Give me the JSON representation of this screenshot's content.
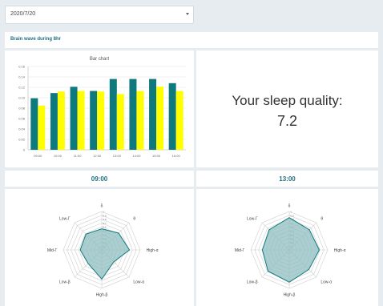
{
  "date_select": {
    "value": "2020/7/20"
  },
  "section_title": "Brain wave during 8hr",
  "chart_data": {
    "type": "bar",
    "title": "Bar chart",
    "categories": [
      "09:00",
      "10:00",
      "11:00",
      "12:00",
      "13:00",
      "14:00",
      "15:00",
      "16:00"
    ],
    "series": [
      {
        "values": [
          0.099,
          0.109,
          0.121,
          0.113,
          0.136,
          0.136,
          0.136,
          0.128
        ]
      },
      {
        "values": [
          0.085,
          0.112,
          0.113,
          0.112,
          0.107,
          0.113,
          0.121,
          0.113
        ]
      }
    ],
    "ylim": [
      0,
      0.16
    ],
    "yticks": [
      "0",
      "0.02",
      "0.04",
      "0.06",
      "0.08",
      "0.10",
      "0.12",
      "0.14",
      "0.16"
    ],
    "colors": [
      "#0e7a7e",
      "#ffff00"
    ]
  },
  "sleep_quality": {
    "label": "Your sleep quality:",
    "value": "7.2"
  },
  "radar_left": {
    "time": "09:00",
    "axes": [
      "δ",
      "θ",
      "High-α",
      "Low-α",
      "High-β",
      "Low-β",
      "Mid-Γ",
      "Low-Γ"
    ],
    "values": [
      0.55,
      0.62,
      0.72,
      0.44,
      0.76,
      0.5,
      0.56,
      0.58
    ],
    "rings": [
      "0.1",
      "0.2",
      "0.3",
      "0.4",
      "0.5",
      "0.6",
      "0.7",
      "0.8",
      "0.9",
      "1"
    ]
  },
  "radar_right": {
    "time": "13:00",
    "axes": [
      "δ",
      "θ",
      "High-α",
      "Low-α",
      "High-β",
      "Low-β",
      "Mid-Γ",
      "Low-Γ"
    ],
    "values": [
      0.84,
      0.74,
      0.78,
      0.72,
      0.84,
      0.78,
      0.7,
      0.74
    ],
    "rings": [
      "0.1",
      "0.2",
      "0.3",
      "0.4",
      "0.5",
      "0.6",
      "0.7",
      "0.8",
      "0.9",
      "1"
    ]
  },
  "colors": {
    "accent": "#1f6f7d",
    "radar_fill": "#8fbec0",
    "radar_stroke": "#0e7a7e"
  }
}
